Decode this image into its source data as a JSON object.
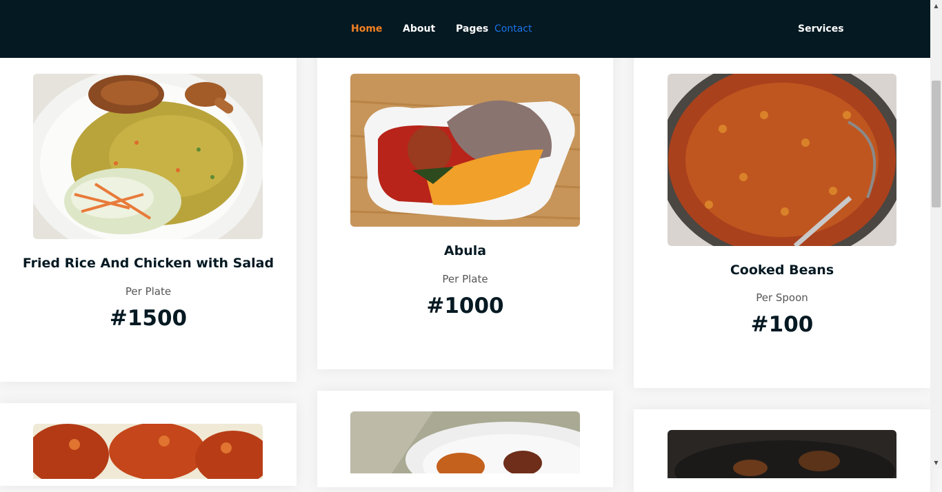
{
  "nav": {
    "items": [
      {
        "label": "Home"
      },
      {
        "label": "About"
      },
      {
        "label": "Pages"
      },
      {
        "label": "Contact"
      },
      {
        "label": "Services"
      }
    ]
  },
  "products": [
    {
      "name": "Fried Rice And Chicken with Salad",
      "unit": "Per Plate",
      "price": "#1500",
      "image": "fried-rice-chicken-photo"
    },
    {
      "name": "Abula",
      "unit": "Per Plate",
      "price": "#1000",
      "image": "abula-photo"
    },
    {
      "name": "Cooked Beans",
      "unit": "Per Spoon",
      "price": "#100",
      "image": "cooked-beans-photo"
    },
    {
      "image": "fried-chicken-photo"
    },
    {
      "image": "fried-plantain-photo"
    },
    {
      "image": "dark-stew-photo"
    }
  ],
  "scrollbar": {
    "up_icon": "arrow-up-icon",
    "down_icon": "arrow-down-icon"
  },
  "colors": {
    "nav_background": "#051922",
    "nav_active": "#f28123",
    "nav_contact": "#1a73e8",
    "text_dark": "#051922"
  }
}
